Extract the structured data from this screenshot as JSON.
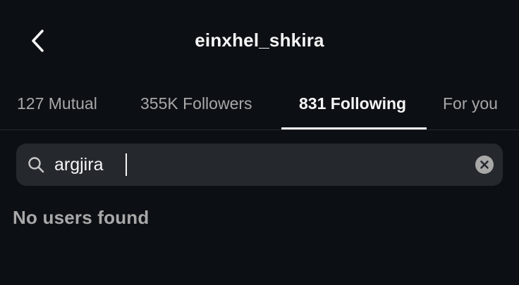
{
  "header": {
    "title": "einxhel_shkira",
    "back_icon": "chevron-left-icon"
  },
  "tabs": [
    {
      "label": "127 Mutual",
      "active": false
    },
    {
      "label": "355K Followers",
      "active": false
    },
    {
      "label": "831 Following",
      "active": true
    },
    {
      "label": "For you",
      "active": false
    }
  ],
  "search": {
    "value": "argjira",
    "icon": "search-icon",
    "clear_icon": "clear-icon"
  },
  "results": {
    "empty_message": "No users found"
  },
  "colors": {
    "background": "#0c1014",
    "search_bg": "#25292e",
    "active_text": "#f5f5f5",
    "inactive_text": "#a8a8a8"
  }
}
